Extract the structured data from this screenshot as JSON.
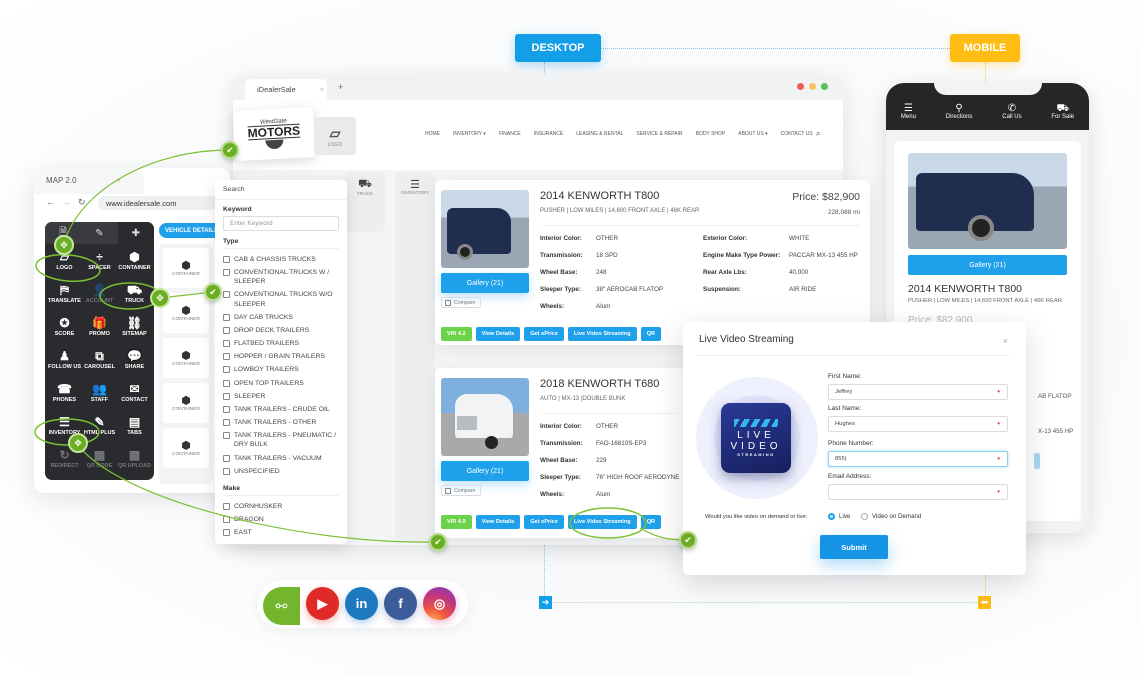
{
  "labels": {
    "desktop": "DESKTOP",
    "mobile": "MOBILE"
  },
  "builder": {
    "tab_title": "MAP 2.0",
    "url": "www.idealersale.com",
    "vehicle_details_button": "VEHICLE DETAILS",
    "toolbox_tabs": [
      {
        "icon": "page-icon"
      },
      {
        "icon": "brush-icon"
      },
      {
        "icon": "puzzle-icon"
      }
    ],
    "tools": [
      {
        "label": "LOGO",
        "icon": "logo-icon",
        "glyph": "▱"
      },
      {
        "label": "SPACER",
        "icon": "spacer-icon",
        "glyph": "÷"
      },
      {
        "label": "CONTAINER",
        "icon": "box-icon",
        "glyph": "⬢"
      },
      {
        "label": "TRANSLATE",
        "icon": "translate-icon",
        "glyph": "⛿"
      },
      {
        "label": "ACCOUNT",
        "icon": "account-icon",
        "glyph": "👤",
        "dim": true
      },
      {
        "label": "TRUCK",
        "icon": "truck-icon",
        "glyph": "⛟"
      },
      {
        "label": "SCORE",
        "icon": "score-icon",
        "glyph": "✪"
      },
      {
        "label": "PROMO",
        "icon": "gift-icon",
        "glyph": "🎁"
      },
      {
        "label": "SITEMAP",
        "icon": "sitemap-icon",
        "glyph": "⛓"
      },
      {
        "label": "FOLLOW US",
        "icon": "follow-icon",
        "glyph": "♟"
      },
      {
        "label": "CAROUSEL",
        "icon": "carousel-icon",
        "glyph": "⧉"
      },
      {
        "label": "SHARE",
        "icon": "share-bubble-icon",
        "glyph": "💬"
      },
      {
        "label": "PHONES",
        "icon": "phone-icon",
        "glyph": "☎"
      },
      {
        "label": "STAFF",
        "icon": "staff-icon",
        "glyph": "👥"
      },
      {
        "label": "CONTACT",
        "icon": "envelope-icon",
        "glyph": "✉"
      },
      {
        "label": "INVENTORY",
        "icon": "inventory-icon",
        "glyph": "☰"
      },
      {
        "label": "HTML PLUS",
        "icon": "html-icon",
        "glyph": "✎"
      },
      {
        "label": "TABS",
        "icon": "tabs-icon",
        "glyph": "▤"
      },
      {
        "label": "REDIRECT",
        "icon": "redirect-icon",
        "glyph": "↻",
        "dim": true
      },
      {
        "label": "QR CODE",
        "icon": "qr-icon",
        "glyph": "▦",
        "dim": true
      },
      {
        "label": "QR UPLOAD",
        "icon": "qr-upload-icon",
        "glyph": "▩",
        "dim": true
      }
    ],
    "containers": [
      "CONTAINER",
      "CONTAINER",
      "CONTAINER",
      "CONTAINER",
      "CONTAINER"
    ]
  },
  "search": {
    "title": "Search",
    "keyword_label": "Keyword",
    "keyword_placeholder": "Enter Keyword",
    "type_label": "Type",
    "types": [
      "CAB & CHASSIS TRUCKS",
      "CONVENTIONAL TRUCKS W / SLEEPER",
      "CONVENTIONAL TRUCKS W/O SLEEPER",
      "DAY CAB TRUCKS",
      "DROP DECK TRAILERS",
      "FLATBED TRAILERS",
      "HOPPER / GRAIN TRAILERS",
      "LOWBOY TRAILERS",
      "OPEN TOP TRAILERS",
      "SLEEPER",
      "TANK TRAILERS - CRUDE OIL",
      "TANK TRAILERS - OTHER",
      "TANK TRAILERS - PNEUMATIC / DRY BULK",
      "TANK TRAILERS - VACUUM",
      "UNSPECIFIED"
    ],
    "make_label": "Make",
    "makes": [
      "CORNHUSKER",
      "DRAGON",
      "EAST"
    ]
  },
  "desktop": {
    "tab_title": "iDealerSale",
    "logo": {
      "top": "WestGate",
      "main": "MOTORS",
      "tile_label": "LOGO"
    },
    "nav": [
      "HOME",
      "INVENTORY ▾",
      "FINANCE",
      "INSURANCE",
      "LEASING & RENTAL",
      "SERVICE & REPAIR",
      "BODY SHOP",
      "ABOUT US ▾",
      "CONTACT US"
    ],
    "tiles": {
      "truck": "TRUCK",
      "inventory": "INVENTORY"
    },
    "listings": [
      {
        "title": "2014 KENWORTH T800",
        "subtitle": "PUSHER | LOW MILES | 14,600 FRONT AXLE | 46K REAR",
        "price": "Price: $82,900",
        "mileage": "228,088 mi",
        "gallery": "Gallery (21)",
        "compare": "Compare",
        "specs_left": [
          [
            "Interior Color:",
            "OTHER"
          ],
          [
            "Transmission:",
            "18 SPD"
          ],
          [
            "Wheel Base:",
            "248"
          ],
          [
            "Sleeper Type:",
            "38\" AEROCAB FLATOP"
          ],
          [
            "Wheels:",
            "Alum"
          ]
        ],
        "specs_right": [
          [
            "Exterior Color:",
            "WHITE"
          ],
          [
            "Engine Make Type Power:",
            "PACCAR MX-13 455 HP"
          ],
          [
            "Rear Axle Lbs:",
            "40,000"
          ],
          [
            "Suspension:",
            "AIR RIDE"
          ]
        ],
        "buttons": [
          "VIR 4.2",
          "View Details",
          "Get ePrice",
          "Live Video Streaming",
          "QR"
        ]
      },
      {
        "title": "2018 KENWORTH T680",
        "subtitle": "AUTO | MX-13 |DOUBLE BUNK",
        "gallery": "Gallery (21)",
        "compare": "Compare",
        "specs_left": [
          [
            "Interior Color:",
            "OTHER"
          ],
          [
            "Transmission:",
            "FAO-16810S-EP3"
          ],
          [
            "Wheel Base:",
            "229"
          ],
          [
            "Sleeper Type:",
            "76\" HIGH ROOF AERODYNE"
          ],
          [
            "Wheels:",
            "Alum"
          ]
        ],
        "buttons": [
          "VIR 4.9",
          "View Details",
          "Get ePrice",
          "Live Video Streaming",
          "QR"
        ]
      }
    ]
  },
  "mobile": {
    "nav": [
      {
        "label": "Menu",
        "glyph": "☰"
      },
      {
        "label": "Directions",
        "glyph": "⚲"
      },
      {
        "label": "Call Us",
        "glyph": "✆"
      },
      {
        "label": "For Sale",
        "glyph": "⛟"
      }
    ],
    "gallery": "Gallery (21)",
    "title": "2014 KENWORTH T800",
    "subtitle": "PUSHER | LOW MILES | 14,600 FRONT AXLE | 46K REAR",
    "price": "Price: $82,900",
    "fragments": [
      "AB FLATOP",
      "X-13 455 HP"
    ]
  },
  "modal": {
    "title": "Live Video Streaming",
    "badge": {
      "line1": "LIVE",
      "line2": "VIDEO",
      "line3": "STREAMING"
    },
    "fields": [
      {
        "label": "First Name:",
        "value": "Jeffrey"
      },
      {
        "label": "Last Name:",
        "value": "Hughes"
      },
      {
        "label": "Phone Number:",
        "value": "855|"
      },
      {
        "label": "Email Address:",
        "value": ""
      }
    ],
    "question": "Would you like video on demand or live:",
    "options": [
      {
        "label": "Live",
        "selected": true
      },
      {
        "label": "Video on Demand",
        "selected": false
      }
    ],
    "submit": "Submit"
  },
  "social": [
    {
      "name": "youtube",
      "glyph": "▶",
      "color": "#e02a27"
    },
    {
      "name": "linkedin",
      "glyph": "in",
      "color": "#1c78bf"
    },
    {
      "name": "facebook",
      "glyph": "f",
      "color": "#3b5b99"
    },
    {
      "name": "instagram",
      "glyph": "◎",
      "color": "#c1367f"
    }
  ],
  "colors": {
    "blue": "#1ea1ea",
    "green": "#6bd34a",
    "yellow": "#ffbd14",
    "accent_green": "#6aae25"
  }
}
